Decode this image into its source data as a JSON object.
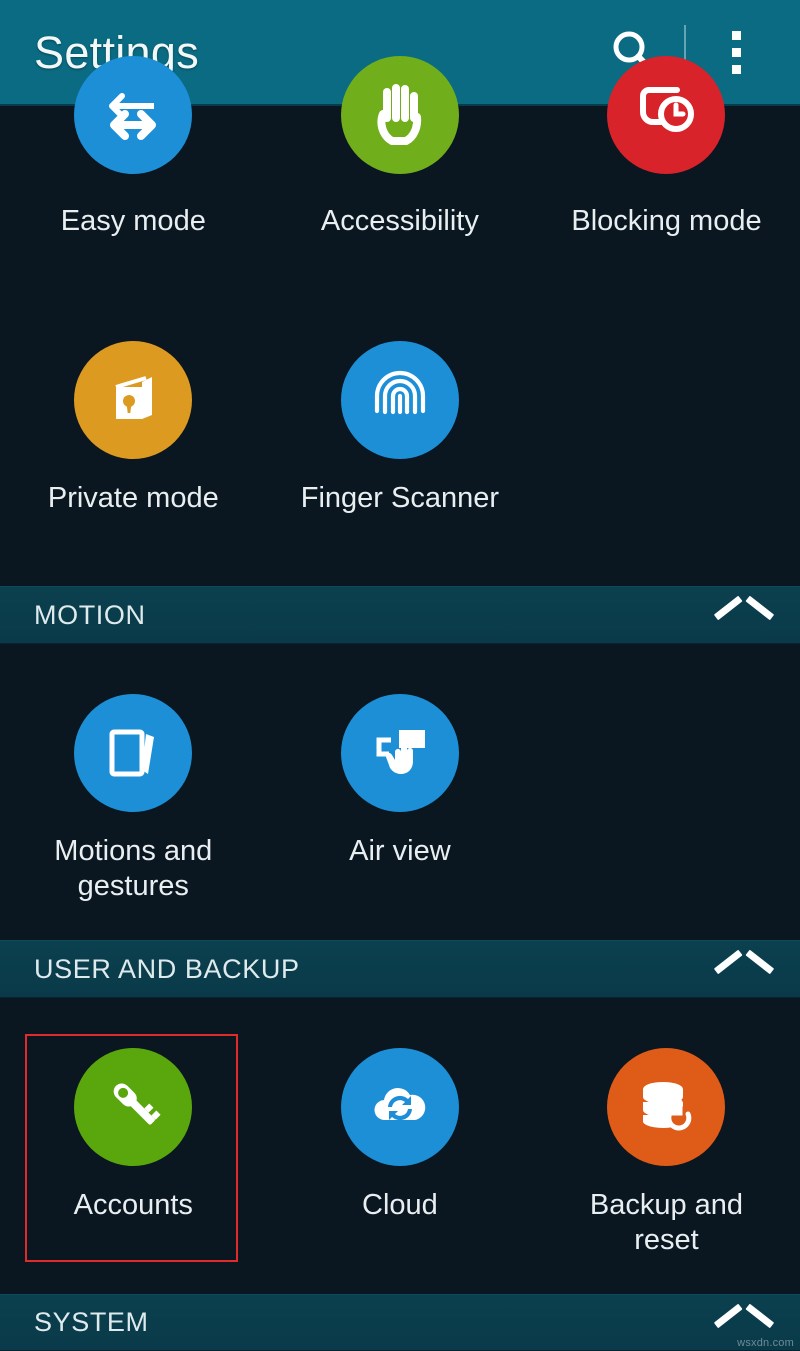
{
  "appbar": {
    "title": "Settings",
    "search_icon": "search-icon",
    "overflow_icon": "more-options-icon"
  },
  "colors": {
    "appbar_teal": "#0a6b82",
    "section_teal": "#0a3d4d",
    "page_background": "#0a1620",
    "label_text": "#e9eff1",
    "selection_red": "#e02b2b",
    "blue": "#1c8fd6",
    "green": "#5aa70d",
    "red": "#d8232a",
    "amber": "#dd9a21",
    "orange": "#de5b18"
  },
  "rows": {
    "top": [
      {
        "label": "Easy mode",
        "icon": "easy-mode-icon",
        "color": "#1c8fd6"
      },
      {
        "label": "Accessibility",
        "icon": "accessibility-icon",
        "color": "#71ae1c"
      },
      {
        "label": "Blocking mode",
        "icon": "blocking-mode-icon",
        "color": "#d8232a"
      }
    ],
    "personal": [
      {
        "label": "Private mode",
        "icon": "private-mode-icon",
        "color": "#dd9a21"
      },
      {
        "label": "Finger Scanner",
        "icon": "fingerprint-icon",
        "color": "#1c8fd6"
      }
    ],
    "motion": [
      {
        "label": "Motions and gestures",
        "icon": "motion-gestures-icon",
        "color": "#1c8fd6"
      },
      {
        "label": "Air view",
        "icon": "air-view-icon",
        "color": "#1c8fd6"
      }
    ],
    "user_backup": [
      {
        "label": "Accounts",
        "icon": "key-icon",
        "color": "#5aa70d",
        "selected": true
      },
      {
        "label": "Cloud",
        "icon": "cloud-sync-icon",
        "color": "#1c8fd6",
        "selected": false
      },
      {
        "label": "Backup and reset",
        "icon": "database-reset-icon",
        "color": "#de5b18",
        "selected": false
      }
    ]
  },
  "sections": [
    {
      "title": "MOTION",
      "collapse_icon": "chevron-up-icon"
    },
    {
      "title": "USER AND BACKUP",
      "collapse_icon": "chevron-up-icon"
    },
    {
      "title": "SYSTEM",
      "collapse_icon": "chevron-up-icon"
    }
  ],
  "watermark": "wsxdn.com"
}
